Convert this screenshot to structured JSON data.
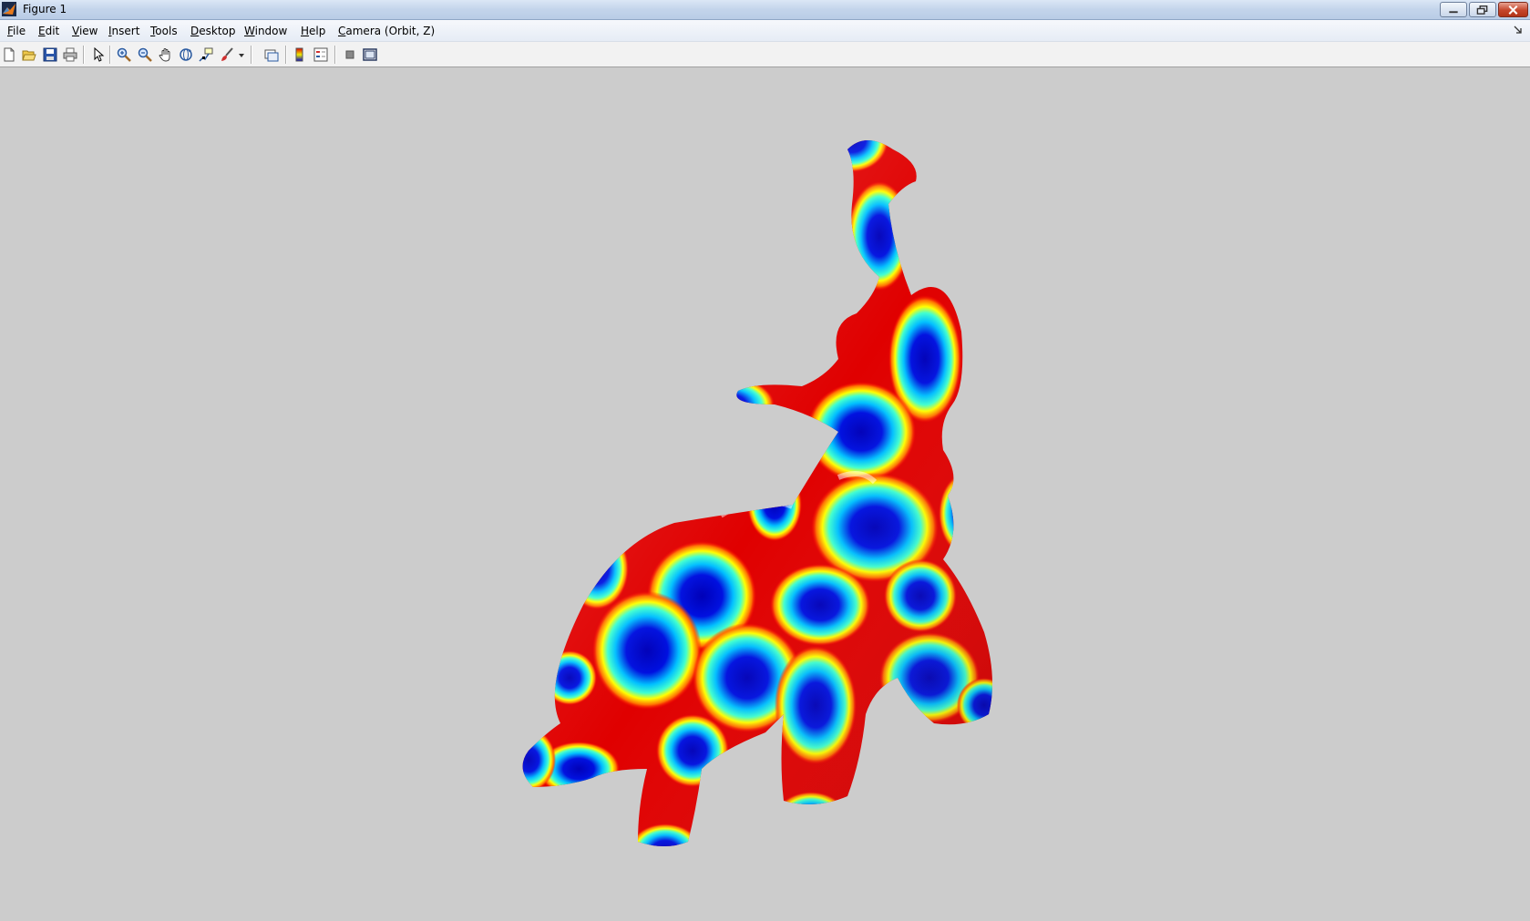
{
  "window": {
    "title": "Figure 1",
    "background_color": "#cccccc",
    "controls": [
      "minimize-icon",
      "restore-icon",
      "close-icon"
    ]
  },
  "menubar": {
    "items": [
      {
        "label": "File"
      },
      {
        "label": "Edit"
      },
      {
        "label": "View"
      },
      {
        "label": "Insert"
      },
      {
        "label": "Tools"
      },
      {
        "label": "Desktop"
      },
      {
        "label": "Window"
      },
      {
        "label": "Help"
      },
      {
        "label": "Camera (Orbit, Z)"
      }
    ]
  },
  "toolbar": {
    "buttons": [
      "new-figure-icon",
      "open-file-icon",
      "save-figure-icon",
      "print-figure-icon",
      "edit-plot-icon",
      "zoom-in-icon",
      "zoom-out-icon",
      "pan-icon",
      "rotate-3d-icon",
      "data-cursor-icon",
      "brush-icon",
      "brush-dropdown-icon",
      "link-plot-icon",
      "insert-colorbar-icon",
      "insert-legend-icon",
      "hide-plot-tools-icon",
      "show-plot-tools-icon"
    ]
  },
  "figure": {
    "content": "elephant-mesh",
    "colormap": [
      "#0000c8",
      "#00c8ff",
      "#ffff00",
      "#ff0000"
    ]
  }
}
